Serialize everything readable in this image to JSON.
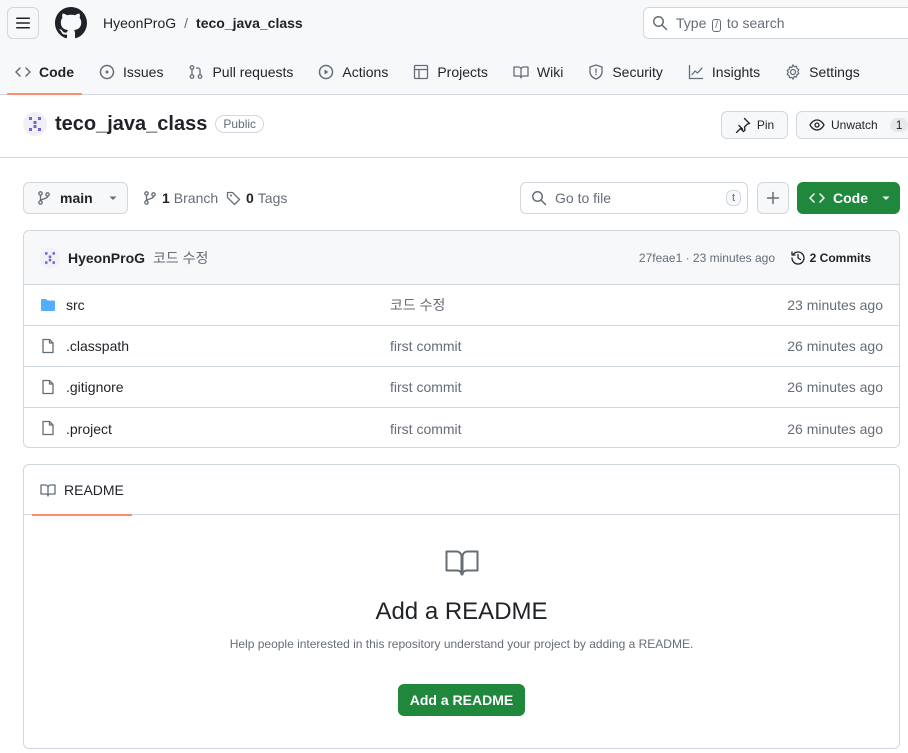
{
  "header": {
    "owner": "HyeonProG",
    "separator": "/",
    "repo": "teco_java_class",
    "search_prefix": "Type",
    "search_key": "/",
    "search_suffix": "to search"
  },
  "tabs": [
    {
      "label": "Code",
      "icon": "code-icon",
      "active": true
    },
    {
      "label": "Issues",
      "icon": "issue-opened-icon"
    },
    {
      "label": "Pull requests",
      "icon": "git-pull-request-icon"
    },
    {
      "label": "Actions",
      "icon": "play-icon"
    },
    {
      "label": "Projects",
      "icon": "table-icon"
    },
    {
      "label": "Wiki",
      "icon": "book-icon"
    },
    {
      "label": "Security",
      "icon": "shield-icon"
    },
    {
      "label": "Insights",
      "icon": "graph-icon"
    },
    {
      "label": "Settings",
      "icon": "gear-icon"
    }
  ],
  "repo": {
    "name": "teco_java_class",
    "visibility": "Public",
    "pin_label": "Pin",
    "watch_label": "Unwatch",
    "watch_count": "1"
  },
  "toolbar": {
    "branch": "main",
    "branches_count": "1",
    "branches_label": "Branch",
    "tags_count": "0",
    "tags_label": "Tags",
    "file_search_placeholder": "Go to file",
    "file_search_key": "t",
    "code_label": "Code"
  },
  "latest_commit": {
    "author": "HyeonProG",
    "message": "코드 수정",
    "hash_time": "27feae1 · 23 minutes ago",
    "commits_label": "2 Commits"
  },
  "files": [
    {
      "name": "src",
      "type": "folder",
      "message": "코드 수정",
      "age": "23 minutes ago"
    },
    {
      "name": ".classpath",
      "type": "file",
      "message": "first commit",
      "age": "26 minutes ago"
    },
    {
      "name": ".gitignore",
      "type": "file",
      "message": "first commit",
      "age": "26 minutes ago"
    },
    {
      "name": ".project",
      "type": "file",
      "message": "first commit",
      "age": "26 minutes ago"
    }
  ],
  "readme": {
    "tab_label": "README",
    "title": "Add a README",
    "description": "Help people interested in this repository understand your project by adding a README.",
    "button_label": "Add a README"
  },
  "colors": {
    "accent_green": "#1f883d",
    "tab_underline": "#fd8c73",
    "folder_blue": "#54aeff"
  }
}
